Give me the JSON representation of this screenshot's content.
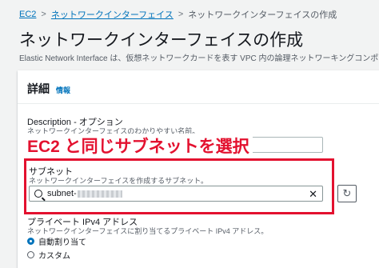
{
  "breadcrumb": {
    "root": "EC2",
    "parent": "ネットワークインターフェイス",
    "current": "ネットワークインターフェイスの作成",
    "separator": ">"
  },
  "page": {
    "title": "ネットワークインターフェイスの作成",
    "description": "Elastic Network Interface は、仮想ネットワークカードを表す VPC 内の論理ネットワーキングコンポーネント"
  },
  "details_panel": {
    "title": "詳細",
    "info_label": "情報",
    "description_field": {
      "label": "Description - オプション",
      "hint": "ネットワークインターフェイスのわかりやすい名前。",
      "value": ""
    },
    "annotation": "EC2 と同じサブネットを選択",
    "subnet_field": {
      "label": "サブネット",
      "hint": "ネットワークインターフェイスを作成するサブネット。",
      "value_prefix": "subnet-",
      "clear_icon": "close-icon",
      "refresh_icon": "refresh-icon"
    },
    "private_ip_field": {
      "label": "プライベート IPv4 アドレス",
      "hint": "ネットワークインターフェイスに割り当てるプライベート IPv4 アドレス。",
      "options": [
        {
          "label": "自動割り当て",
          "selected": true
        },
        {
          "label": "カスタム",
          "selected": false
        }
      ]
    }
  },
  "colors": {
    "link": "#0073bb",
    "annotation_red": "#e3112f",
    "background": "#f2f3f3"
  }
}
